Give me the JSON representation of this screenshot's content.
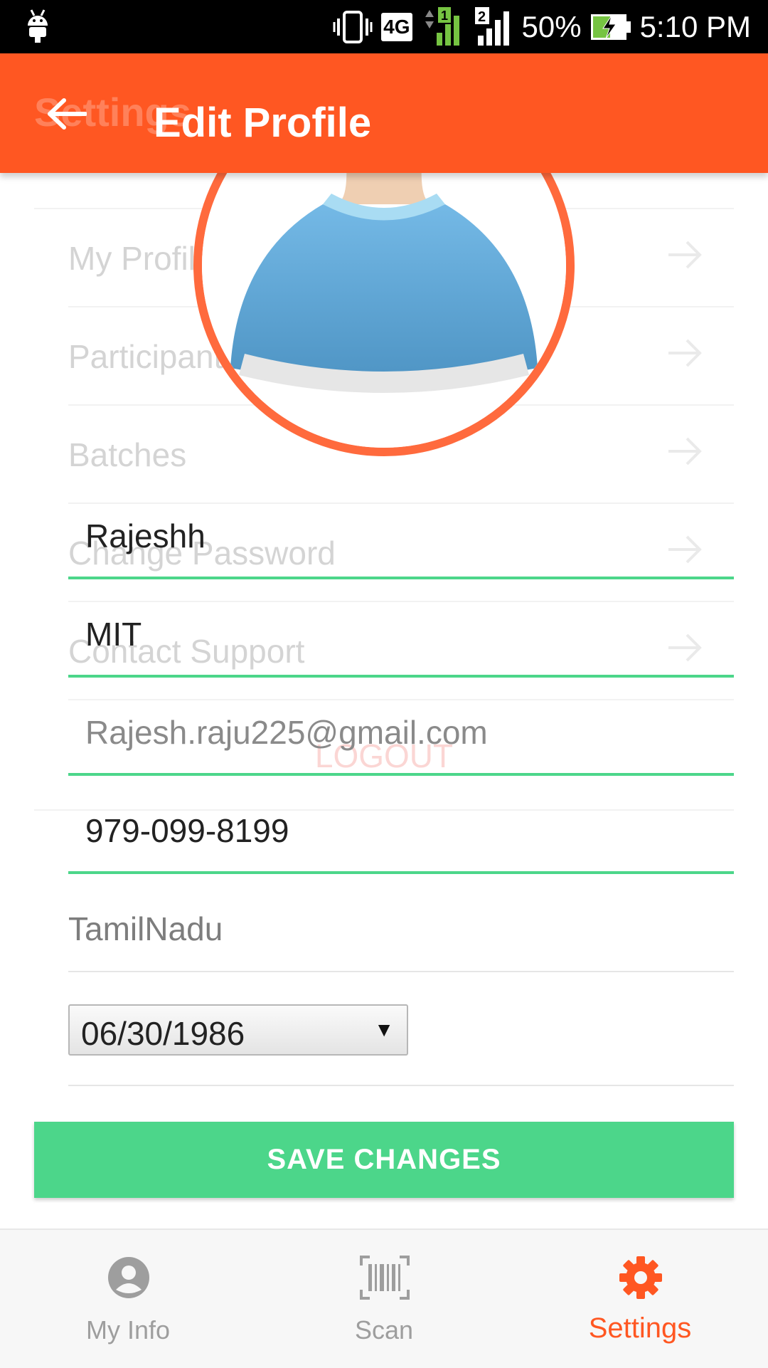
{
  "status_bar": {
    "network": "4G",
    "sim1": "1",
    "sim2": "2",
    "battery": "50%",
    "time": "5:10 PM"
  },
  "app_bar": {
    "ghost_title": "Settings",
    "title": "Edit Profile"
  },
  "background_menu": {
    "items": [
      {
        "label": "My Profile"
      },
      {
        "label": "Participant Details"
      },
      {
        "label": "Batches"
      },
      {
        "label": "Change Password"
      },
      {
        "label": "Contact Support"
      }
    ],
    "logout": "LOGOUT"
  },
  "form": {
    "name": "Rajeshh",
    "college": "MIT",
    "email": "Rajesh.raju225@gmail.com",
    "phone": "979-099-8199",
    "state": "TamilNadu",
    "dob": "06/30/1986"
  },
  "save_button": "SAVE CHANGES",
  "bottom_nav": {
    "items": [
      {
        "label": "My Info",
        "icon": "person-circle-icon"
      },
      {
        "label": "Scan",
        "icon": "barcode-icon"
      },
      {
        "label": "Settings",
        "icon": "gear-icon",
        "active": true
      }
    ]
  },
  "colors": {
    "primary": "#ff5722",
    "accent": "#4cd68a",
    "avatar_ring": "#ff6a3d"
  }
}
